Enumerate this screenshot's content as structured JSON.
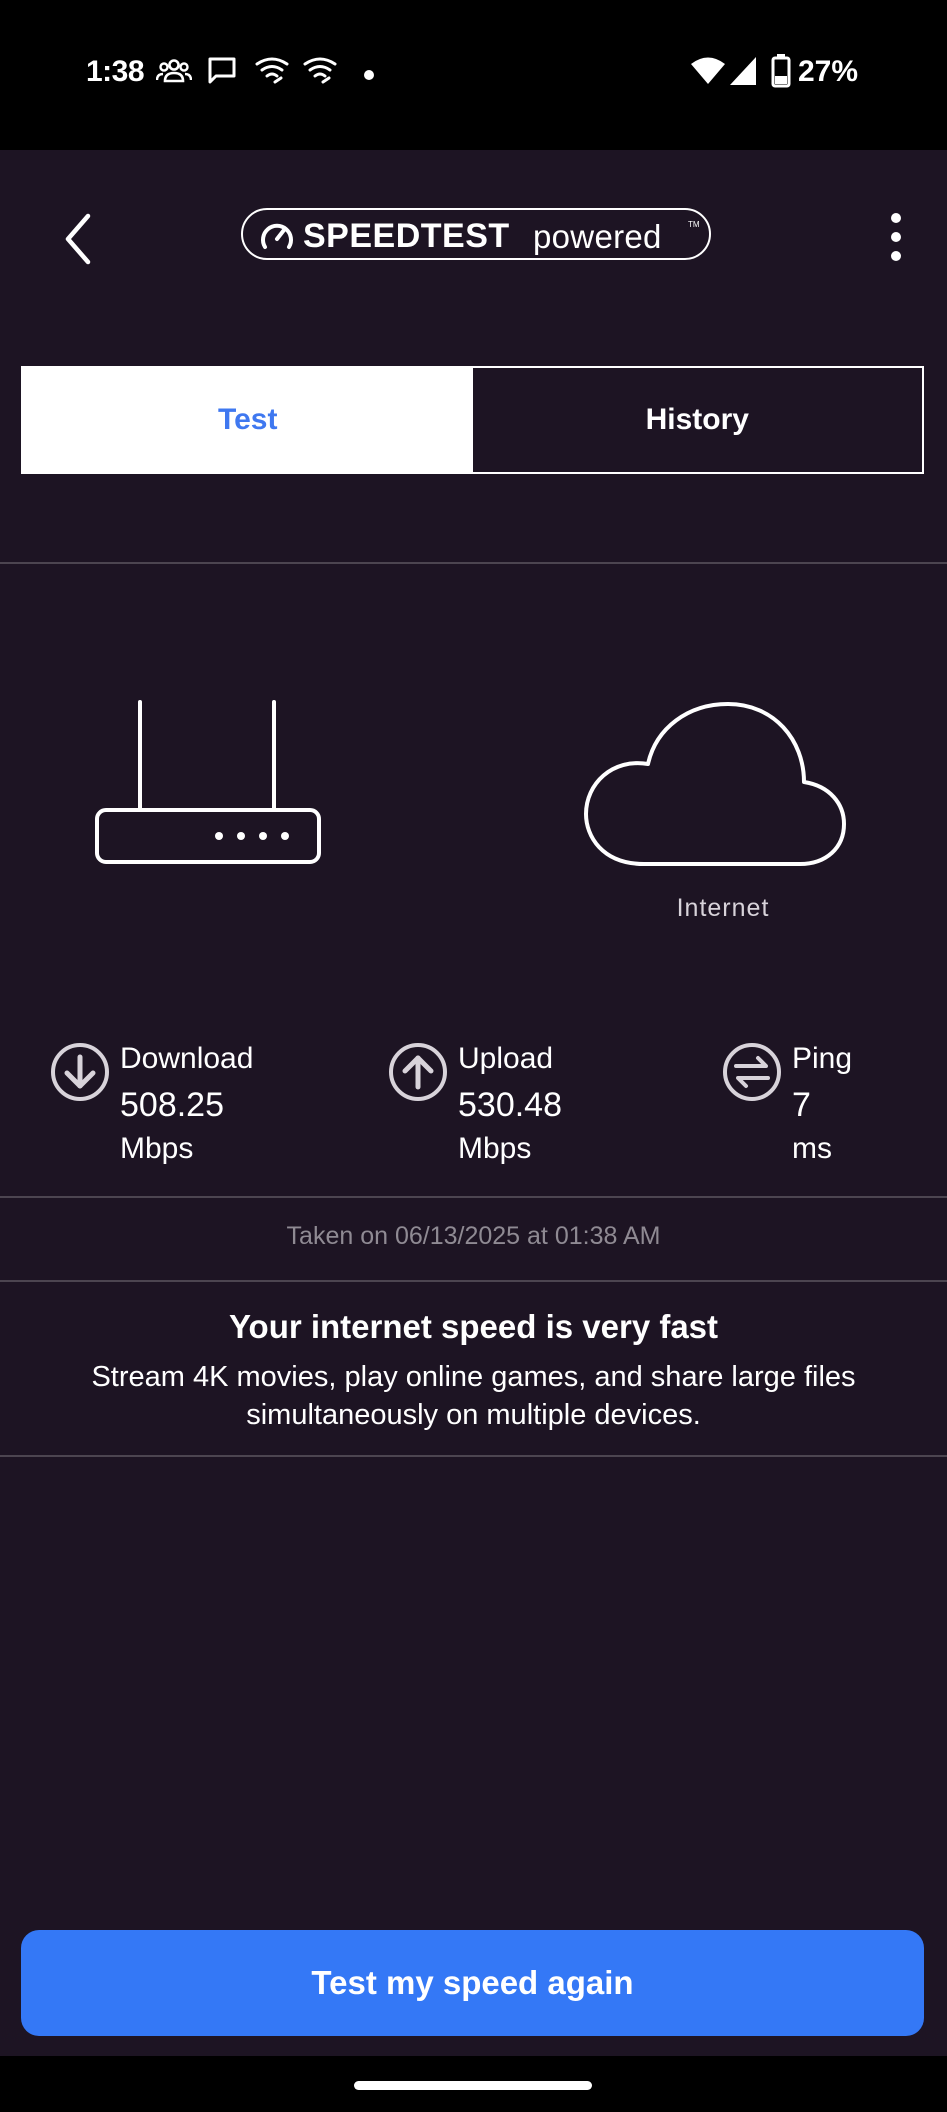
{
  "status_bar": {
    "time": "1:38",
    "battery": "27%",
    "icons": [
      "group-icon",
      "message-icon",
      "wifi-calling-icon",
      "wifi-calling-icon",
      "dot-icon",
      "wifi-icon",
      "signal-icon",
      "battery-icon"
    ]
  },
  "header": {
    "back_icon": "chevron-left-icon",
    "logo_brand": "SPEEDTEST",
    "logo_sub": "powered",
    "logo_tm": "TM",
    "menu_icon": "kebab-menu-icon"
  },
  "tabs": [
    {
      "label": "Test",
      "active": true
    },
    {
      "label": "History",
      "active": false
    }
  ],
  "graphic": {
    "router_icon": "router-icon",
    "cloud_icon": "cloud-icon",
    "internet_label": "Internet"
  },
  "metrics": {
    "download": {
      "label": "Download",
      "value": "508.25",
      "unit": "Mbps",
      "icon": "arrow-down-circle-icon"
    },
    "upload": {
      "label": "Upload",
      "value": "530.48",
      "unit": "Mbps",
      "icon": "arrow-up-circle-icon"
    },
    "ping": {
      "label": "Ping",
      "value": "7",
      "unit": "ms",
      "icon": "ping-circle-icon"
    }
  },
  "taken_on": "Taken on 06/13/2025 at 01:38 AM",
  "verdict": {
    "title": "Your internet speed is very fast",
    "description": "Stream 4K movies, play online games, and share large files simultaneously on multiple devices."
  },
  "cta_label": "Test my speed again",
  "colors": {
    "background": "#1d1423",
    "accent": "#3478f6",
    "active_tab_text": "#3f78f0",
    "divider": "#4c4550"
  }
}
